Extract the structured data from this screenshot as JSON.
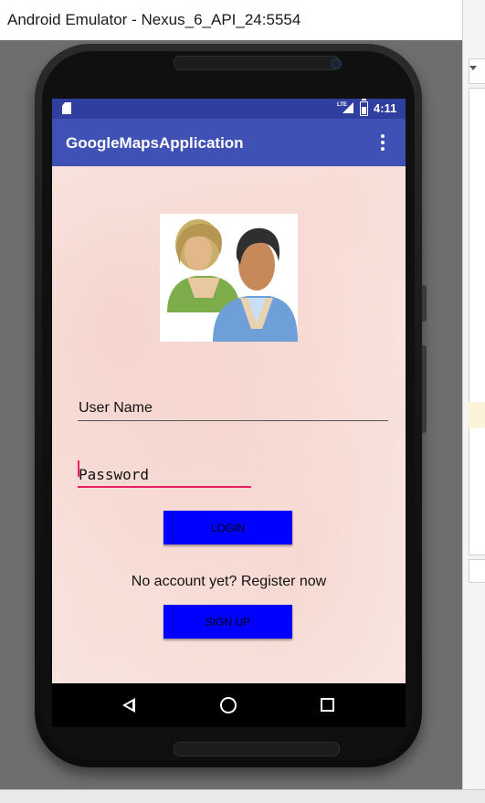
{
  "window": {
    "title": "Android Emulator - Nexus_6_API_24:5554"
  },
  "status_bar": {
    "time": "4:11",
    "network": "LTE",
    "icons": [
      "sim-card-icon",
      "lte-signal-icon",
      "battery-icon"
    ]
  },
  "app_bar": {
    "title": "GoogleMapsApplication",
    "overflow_icon": "more-vert-icon"
  },
  "login_form": {
    "avatar": "users-avatar-icon",
    "username_hint": "User Name",
    "password_hint": "Password",
    "login_label": "LOGIN",
    "register_prompt": "No account yet? Register now",
    "signup_label": "SIGN UP"
  },
  "nav_bar": {
    "icons": [
      "back-icon",
      "home-icon",
      "recents-icon"
    ]
  },
  "colors": {
    "status_bar": "#303f9f",
    "app_bar": "#3f51b5",
    "button": "#0000ff",
    "accent": "#e91e63",
    "background_tint": "#fbebe6"
  }
}
